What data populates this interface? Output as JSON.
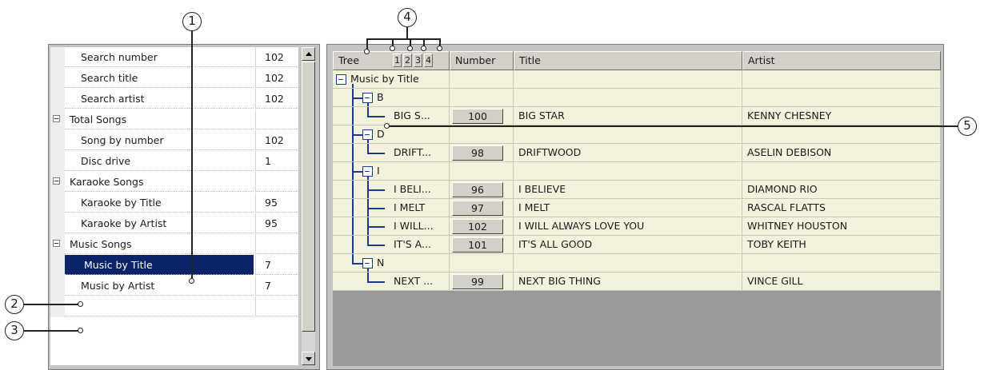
{
  "callouts": [
    "1",
    "2",
    "3",
    "4",
    "5"
  ],
  "left_panel": {
    "rows": [
      {
        "label": "Search number",
        "value": "102",
        "type": "item"
      },
      {
        "label": "Search title",
        "value": "102",
        "type": "item"
      },
      {
        "label": "Search artist",
        "value": "102",
        "type": "item"
      },
      {
        "label": "Total Songs",
        "value": "",
        "type": "category"
      },
      {
        "label": "Song by number",
        "value": "102",
        "type": "item"
      },
      {
        "label": "Disc drive",
        "value": "1",
        "type": "item"
      },
      {
        "label": "Karaoke Songs",
        "value": "",
        "type": "category"
      },
      {
        "label": "Karaoke by Title",
        "value": "95",
        "type": "item"
      },
      {
        "label": "Karaoke by Artist",
        "value": "95",
        "type": "item"
      },
      {
        "label": "Music Songs",
        "value": "",
        "type": "category"
      },
      {
        "label": "Music by Title",
        "value": "7",
        "type": "item",
        "selected": true
      },
      {
        "label": "Music by Artist",
        "value": "7",
        "type": "item"
      },
      {
        "label": "",
        "value": "",
        "type": "item"
      }
    ]
  },
  "grid": {
    "headers": {
      "tree": "Tree",
      "levels": [
        "1",
        "2",
        "3",
        "4"
      ],
      "number": "Number",
      "title": "Title",
      "artist": "Artist"
    },
    "rows": [
      {
        "kind": "root",
        "tree": "Music by Title"
      },
      {
        "kind": "group",
        "tree": "B"
      },
      {
        "kind": "song",
        "tree": "BIG S...",
        "number": "100",
        "title": "BIG STAR",
        "artist": "KENNY CHESNEY"
      },
      {
        "kind": "group",
        "tree": "D"
      },
      {
        "kind": "song",
        "tree": "DRIFT...",
        "number": "98",
        "title": "DRIFTWOOD",
        "artist": "ASELIN DEBISON"
      },
      {
        "kind": "group",
        "tree": "I"
      },
      {
        "kind": "song",
        "tree": "I BELI...",
        "number": "96",
        "title": "I BELIEVE",
        "artist": "DIAMOND RIO"
      },
      {
        "kind": "song",
        "tree": "I MELT",
        "number": "97",
        "title": "I MELT",
        "artist": "RASCAL FLATTS"
      },
      {
        "kind": "song",
        "tree": "I WILL...",
        "number": "102",
        "title": "I WILL ALWAYS LOVE YOU",
        "artist": "WHITNEY HOUSTON"
      },
      {
        "kind": "song",
        "tree": "IT'S A...",
        "number": "101",
        "title": "IT'S ALL GOOD",
        "artist": "TOBY KEITH"
      },
      {
        "kind": "group",
        "tree": "N"
      },
      {
        "kind": "song",
        "tree": "NEXT ...",
        "number": "99",
        "title": "NEXT BIG THING",
        "artist": "VINCE GILL"
      }
    ]
  },
  "colors": {
    "selected_bg": "#0a246a",
    "row_bg": "#f3f2dc",
    "tree_line": "#1e3a8a"
  }
}
